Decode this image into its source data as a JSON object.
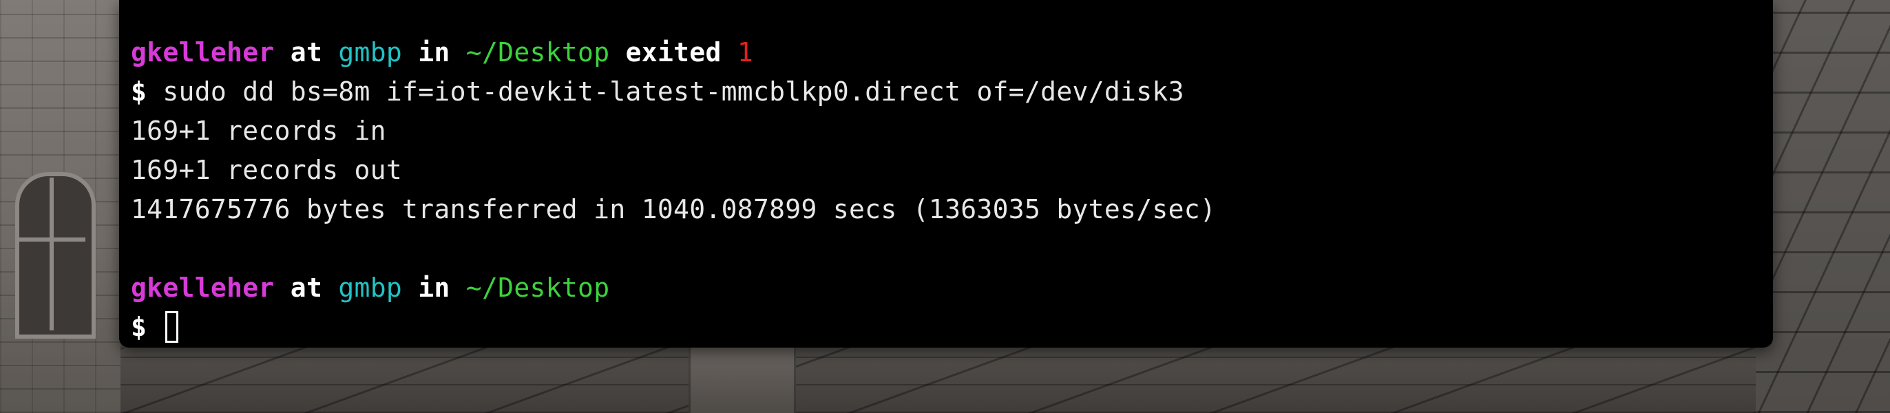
{
  "terminal": {
    "first_prompt": {
      "user": "gkelleher",
      "at_word": "at",
      "host": "gmbp",
      "in_word": "in",
      "path": "~/Desktop",
      "status_word": "exited",
      "exit_code": "1"
    },
    "command_line": {
      "symbol": "$",
      "command": "sudo dd bs=8m if=iot-devkit-latest-mmcblkp0.direct of=/dev/disk3"
    },
    "output_lines": [
      "169+1 records in",
      "169+1 records out",
      "1417675776 bytes transferred in 1040.087899 secs (1363035 bytes/sec)"
    ],
    "second_prompt": {
      "user": "gkelleher",
      "at_word": "at",
      "host": "gmbp",
      "in_word": "in",
      "path": "~/Desktop"
    },
    "input_line": {
      "symbol": "$",
      "value": ""
    }
  },
  "colors": {
    "user": "#d83ad8",
    "host": "#22c2c4",
    "path": "#3dd23d",
    "exit_code": "#e02020",
    "background": "#000000",
    "text": "#e8e8e8"
  }
}
